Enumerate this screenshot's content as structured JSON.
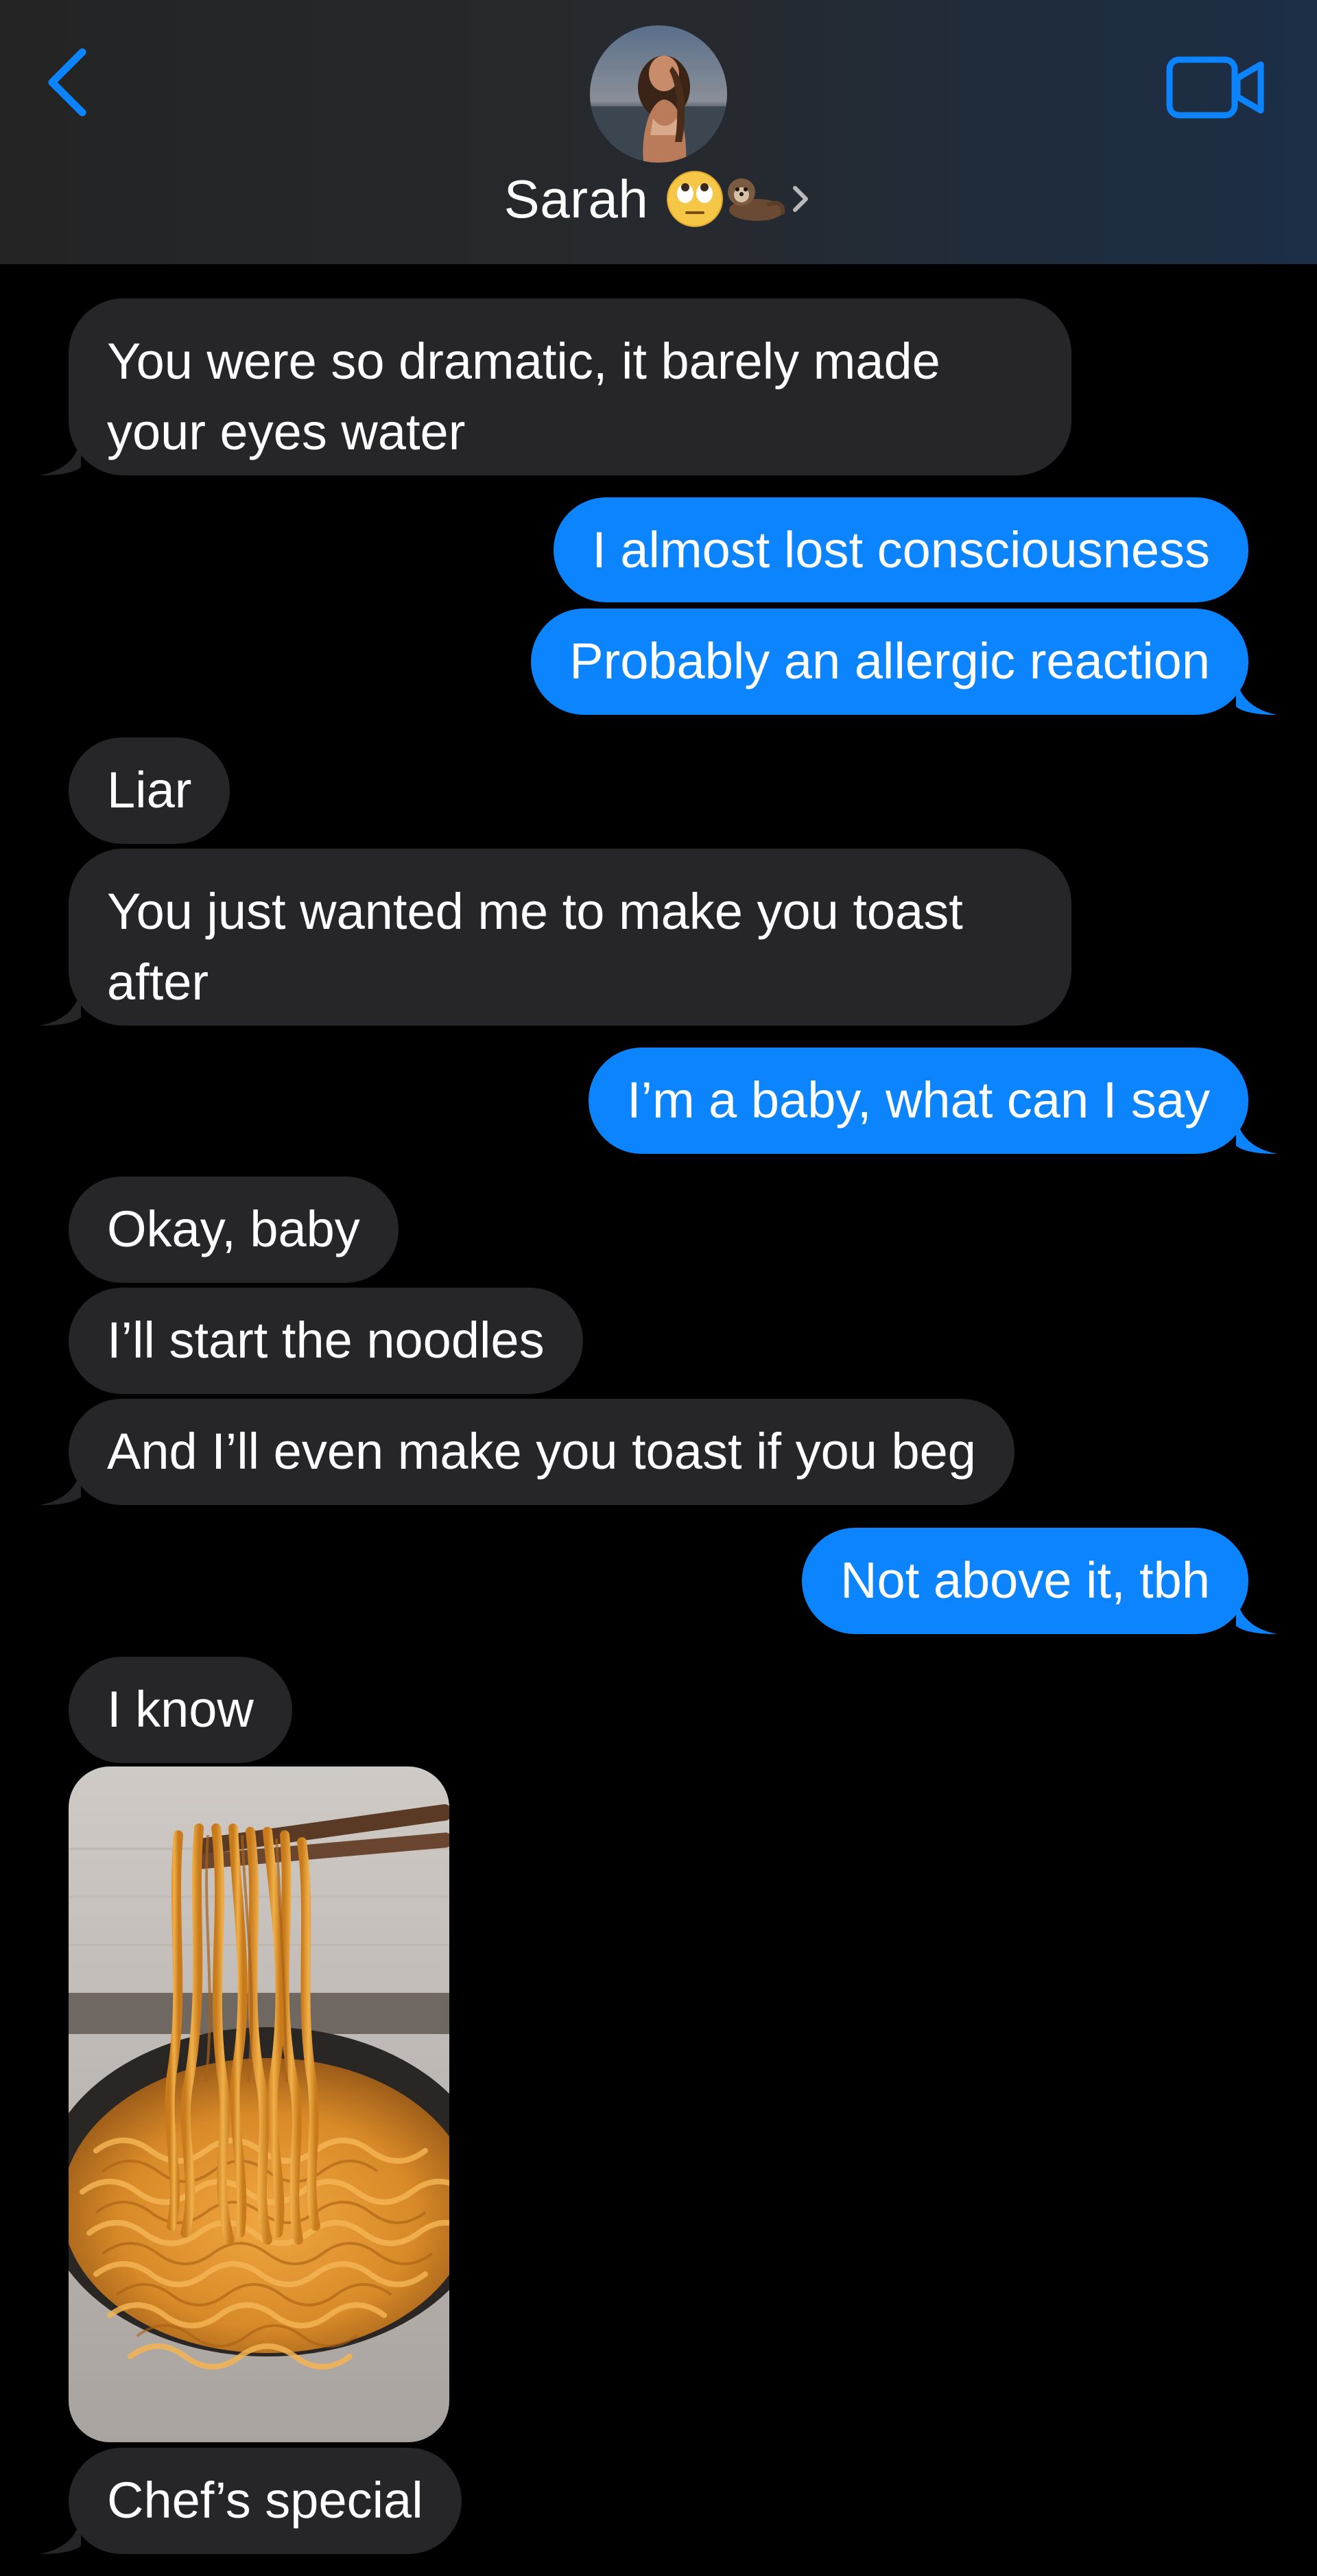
{
  "header": {
    "contact_name": "Sarah",
    "back_icon": "chevron-left-icon",
    "video_icon": "video-camera-icon",
    "accent_color": "#0b84fe"
  },
  "messages": [
    {
      "from": "them",
      "text": "You were so dramatic, it barely made your eyes water"
    },
    {
      "from": "me",
      "text": "I almost lost consciousness"
    },
    {
      "from": "me",
      "text": "Probably an allergic reaction"
    },
    {
      "from": "them",
      "text": "Liar"
    },
    {
      "from": "them",
      "text": "You just wanted me to make you toast after"
    },
    {
      "from": "me",
      "text": "I’m a baby, what can I say"
    },
    {
      "from": "them",
      "text": "Okay, baby"
    },
    {
      "from": "them",
      "text": "I’ll start the noodles"
    },
    {
      "from": "them",
      "text": "And I’ll even make you toast if you beg"
    },
    {
      "from": "me",
      "text": "Not above it, tbh"
    },
    {
      "from": "them",
      "text": "I know"
    },
    {
      "from": "them",
      "type": "photo",
      "subject": "noodles"
    },
    {
      "from": "them",
      "text": "Chef’s special"
    }
  ],
  "colors": {
    "sent_bubble": "#0b84fe",
    "received_bubble": "#262628",
    "background": "#000000"
  }
}
